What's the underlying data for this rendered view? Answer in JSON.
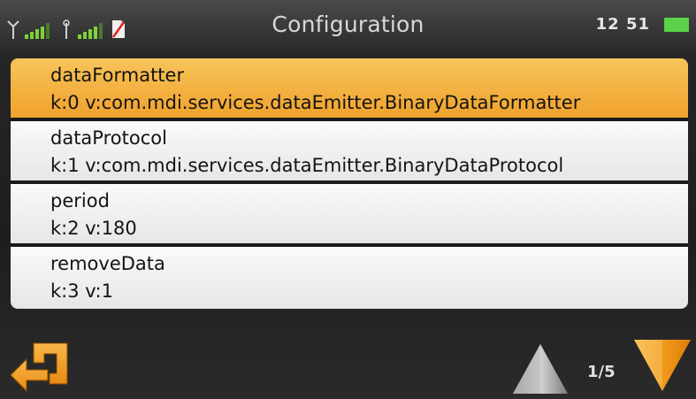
{
  "status_bar": {
    "title": "Configuration",
    "time": "12 51",
    "icons": [
      "antenna-signal-icon",
      "gps-signal-icon",
      "no-sim-icon",
      "battery-icon"
    ]
  },
  "config_list": {
    "items": [
      {
        "name": "dataFormatter",
        "value": "k:0 v:com.mdi.services.dataEmitter.BinaryDataFormatter",
        "selected": true
      },
      {
        "name": "dataProtocol",
        "value": "k:1 v:com.mdi.services.dataEmitter.BinaryDataProtocol",
        "selected": false
      },
      {
        "name": "period",
        "value": "k:2 v:180",
        "selected": false
      },
      {
        "name": "removeData",
        "value": "k:3 v:1",
        "selected": false
      }
    ]
  },
  "navigation": {
    "page_indicator": "1/5",
    "back_icon": "back-arrow-icon",
    "up_icon": "up-arrow-icon",
    "down_icon": "down-arrow-icon"
  },
  "colors": {
    "selected_item": "#f0a22c",
    "signal_green": "#7fd13a",
    "battery_green": "#5ad24a",
    "arrow_orange": "#f2a023"
  }
}
